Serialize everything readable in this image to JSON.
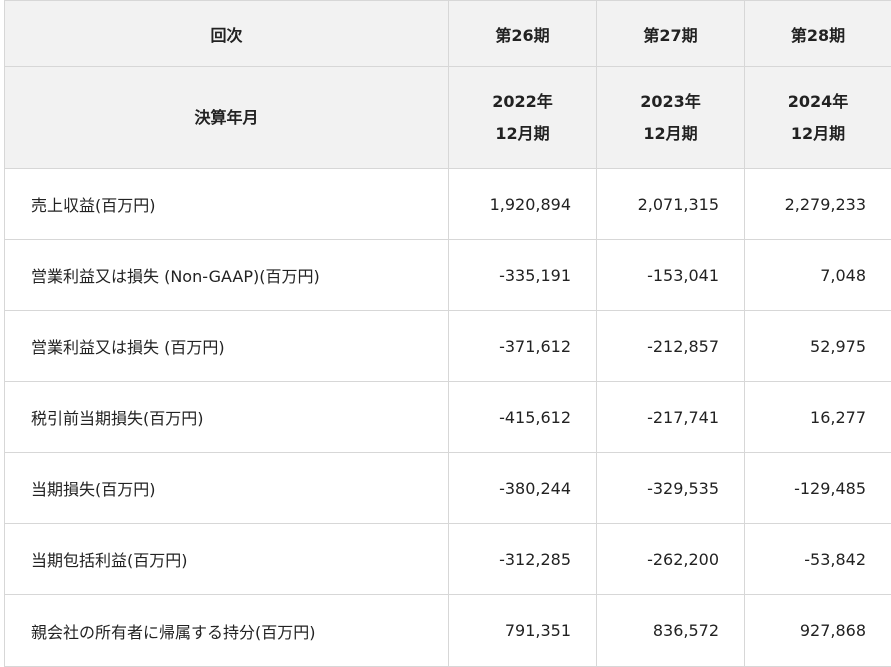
{
  "header": {
    "row1_label": "回次",
    "row2_label": "決算年月",
    "periods": [
      {
        "term": "第26期",
        "year": "2022年",
        "month": "12月期"
      },
      {
        "term": "第27期",
        "year": "2023年",
        "month": "12月期"
      },
      {
        "term": "第28期",
        "year": "2024年",
        "month": "12月期"
      }
    ]
  },
  "rows": [
    {
      "label": "売上収益(百万円)",
      "values": [
        "1,920,894",
        "2,071,315",
        "2,279,233"
      ]
    },
    {
      "label": "営業利益又は損失 (Non-GAAP)(百万円)",
      "values": [
        "-335,191",
        "-153,041",
        "7,048"
      ]
    },
    {
      "label": "営業利益又は損失 (百万円)",
      "values": [
        "-371,612",
        "-212,857",
        "52,975"
      ]
    },
    {
      "label": "税引前当期損失(百万円)",
      "values": [
        "-415,612",
        "-217,741",
        "16,277"
      ]
    },
    {
      "label": "当期損失(百万円)",
      "values": [
        "-380,244",
        "-329,535",
        "-129,485"
      ]
    },
    {
      "label": "当期包括利益(百万円)",
      "values": [
        "-312,285",
        "-262,200",
        "-53,842"
      ]
    },
    {
      "label": "親会社の所有者に帰属する持分(百万円)",
      "values": [
        "791,351",
        "836,572",
        "927,868"
      ]
    }
  ]
}
